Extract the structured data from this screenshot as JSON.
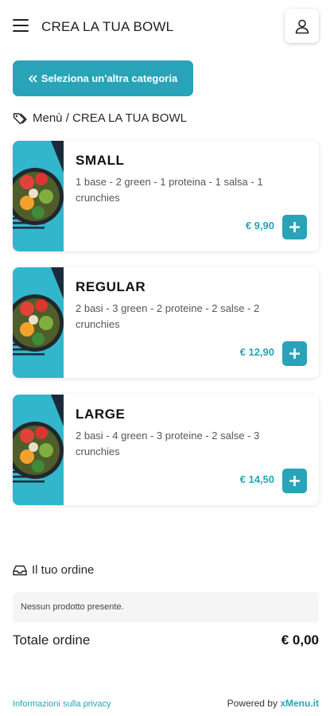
{
  "header": {
    "title": "CREA LA TUA BOWL",
    "menu_icon": "hamburger-icon",
    "user_icon": "user-icon"
  },
  "category_button": {
    "label": "Seleziona un'altra categoria",
    "icon": "double-chevron-left-icon"
  },
  "breadcrumb": {
    "text": "Menù / CREA LA TUA BOWL",
    "icon": "tag-icon"
  },
  "products": [
    {
      "name": "SMALL",
      "description": "1 base - 2 green - 1 proteina - 1 salsa - 1 crunchies",
      "price": "€ 9,90"
    },
    {
      "name": "REGULAR",
      "description": "2 basi - 3 green - 2 proteine - 2 salse - 2 crunchies",
      "price": "€ 12,90"
    },
    {
      "name": "LARGE",
      "description": "2 basi - 4 green - 3 proteine - 2 salse - 3 crunchies",
      "price": "€ 14,50"
    }
  ],
  "order": {
    "title": "Il tuo ordine",
    "icon": "inbox-icon",
    "empty_text": "Nessun prodotto presente.",
    "total_label": "Totale ordine",
    "total_value": "€ 0,00"
  },
  "footer": {
    "privacy": "Informazioni sulla privacy",
    "powered_by": "Powered by",
    "brand": "xMenu.it"
  },
  "colors": {
    "accent": "#28a3b7",
    "image_bg": "#32b6cb"
  }
}
